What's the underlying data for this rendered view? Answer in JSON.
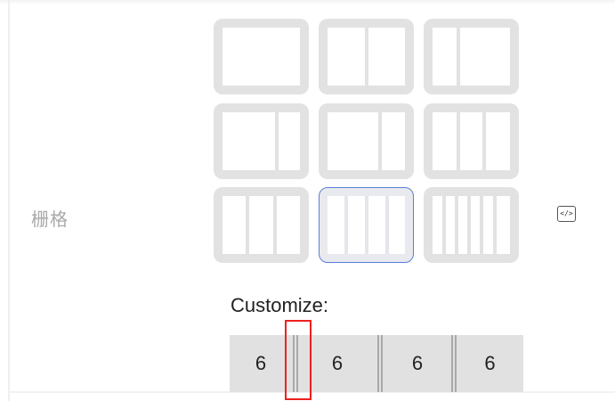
{
  "form": {
    "grid_label": "栅格",
    "customize_label": "Customize:",
    "selected_layout": "3-3-3-3"
  },
  "layout_options": [
    {
      "name": "1 column"
    },
    {
      "name": "6-6"
    },
    {
      "name": "4-8"
    },
    {
      "name": "8-4"
    },
    {
      "name": "8-4 variant"
    },
    {
      "name": "4-4-4 variant"
    },
    {
      "name": "4-4-4"
    },
    {
      "name": "3-3-3-3"
    },
    {
      "name": "2-2-2-2-2-2"
    }
  ],
  "custom_columns": [
    "6",
    "6",
    "6",
    "6"
  ],
  "icons": {
    "code": "code-icon",
    "code_glyph": "</>"
  },
  "colors": {
    "selected_border": "#5b7fd8",
    "highlight": "#ee2020",
    "tile_gray": "#e2e2e2"
  }
}
